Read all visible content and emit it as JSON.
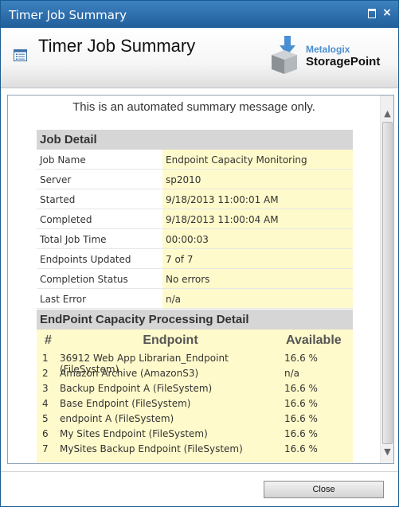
{
  "window": {
    "title": "Timer Job Summary",
    "close_glyph": "×"
  },
  "header": {
    "title": "Timer Job Summary",
    "logo": {
      "brand": "Metalogix",
      "product": "StoragePoint"
    }
  },
  "notice": "This is an automated summary message only.",
  "job_detail": {
    "heading": "Job Detail",
    "rows": [
      {
        "label": "Job Name",
        "value": "Endpoint Capacity Monitoring"
      },
      {
        "label": "Server",
        "value": "sp2010"
      },
      {
        "label": "Started",
        "value": "9/18/2013 11:00:01 AM"
      },
      {
        "label": "Completed",
        "value": "9/18/2013 11:00:04 AM"
      },
      {
        "label": "Total Job Time",
        "value": "00:00:03"
      },
      {
        "label": "Endpoints Updated",
        "value": "7 of 7"
      },
      {
        "label": "Completion Status",
        "value": "No errors"
      },
      {
        "label": "Last Error",
        "value": "n/a"
      }
    ]
  },
  "capacity_detail": {
    "heading": "EndPoint Capacity Processing Detail",
    "columns": {
      "num": "#",
      "name": "Endpoint",
      "available": "Available"
    },
    "rows": [
      {
        "num": "1",
        "name": "36912 Web App Librarian_Endpoint (FileSystem)",
        "available": "16.6 %"
      },
      {
        "num": "2",
        "name": "Amazon Archive (AmazonS3)",
        "available": "n/a"
      },
      {
        "num": "3",
        "name": "Backup Endpoint A (FileSystem)",
        "available": "16.6 %"
      },
      {
        "num": "4",
        "name": "Base Endpoint (FileSystem)",
        "available": "16.6 %"
      },
      {
        "num": "5",
        "name": "endpoint A (FileSystem)",
        "available": "16.6 %"
      },
      {
        "num": "6",
        "name": "My Sites Endpoint (FileSystem)",
        "available": "16.6 %"
      },
      {
        "num": "7",
        "name": "MySites Backup Endpoint (FileSystem)",
        "available": "16.6 %"
      }
    ]
  },
  "footer": {
    "close_label": "Close"
  },
  "icons": {
    "page_icon": "page-list-icon",
    "logo_icon": "storagepoint-box-icon",
    "maximize": "maximize-icon",
    "close": "close-icon",
    "scroll_up": "scroll-up-arrow-icon",
    "scroll_down": "scroll-down-arrow-icon"
  },
  "colors": {
    "titlebar": "#2a6cab",
    "section_header": "#d6d6d6",
    "value_highlight": "#fffacb",
    "brand_blue": "#4a8fd1"
  }
}
